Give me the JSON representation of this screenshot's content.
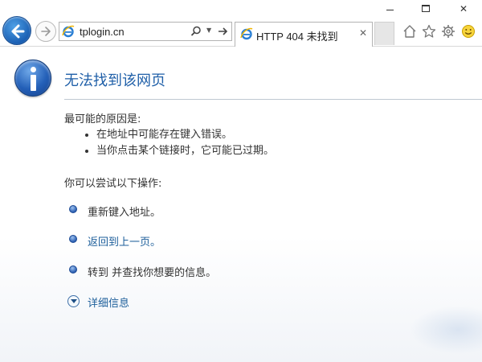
{
  "browser": {
    "window_controls": {
      "minimize": "minimize-icon",
      "maximize": "maximize-icon",
      "close": "✕"
    },
    "nav": {
      "back_icon": "back-arrow-icon",
      "forward_icon": "forward-arrow-icon"
    },
    "address_bar": {
      "url": "tplogin.cn",
      "icons": [
        "ie-logo-icon",
        "search-icon",
        "dropdown-icon",
        "refresh-icon"
      ]
    },
    "tabs": [
      {
        "title": "HTTP 404 未找到",
        "close": "✕",
        "icon": "ie-logo-icon"
      }
    ],
    "toolbar_icons": [
      "home-icon",
      "star-icon",
      "gear-icon",
      "smiley-icon"
    ]
  },
  "page": {
    "title": "无法找到该网页",
    "reasons": {
      "heading": "最可能的原因是:",
      "items": [
        "在地址中可能存在键入错误。",
        "当你点击某个链接时，它可能已过期。"
      ]
    },
    "actions": {
      "heading": "你可以尝试以下操作:",
      "items": [
        {
          "text": "重新键入地址。",
          "link": false
        },
        {
          "text": "返回到上一页。",
          "link": true
        },
        {
          "text": "转到  并查找你想要的信息。",
          "link": false
        }
      ]
    },
    "more_info": "详细信息"
  },
  "colors": {
    "title_blue": "#1f5fa8",
    "link_blue": "#1e5f9b",
    "text": "#333333",
    "divider": "#bfc8d2"
  }
}
